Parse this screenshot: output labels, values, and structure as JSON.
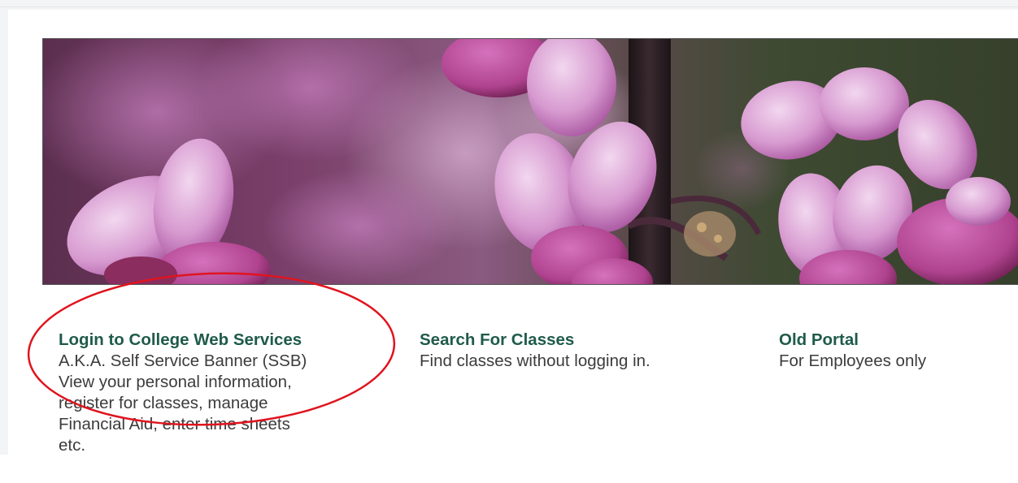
{
  "links": {
    "login": {
      "title": "Login to College Web Services",
      "line1": "A.K.A. Self Service Banner (SSB)",
      "line2": "View your personal information,",
      "line3": "register for classes, manage",
      "line4": "Financial Aid, enter time sheets",
      "line5": "etc."
    },
    "search": {
      "title": "Search For Classes",
      "desc": "Find classes without logging in."
    },
    "portal": {
      "title": "Old Portal",
      "desc": "For Employees only"
    }
  },
  "colors": {
    "link_title": "#1f5b4a",
    "annotation": "#e0141e",
    "flower": "#c46bb8"
  }
}
